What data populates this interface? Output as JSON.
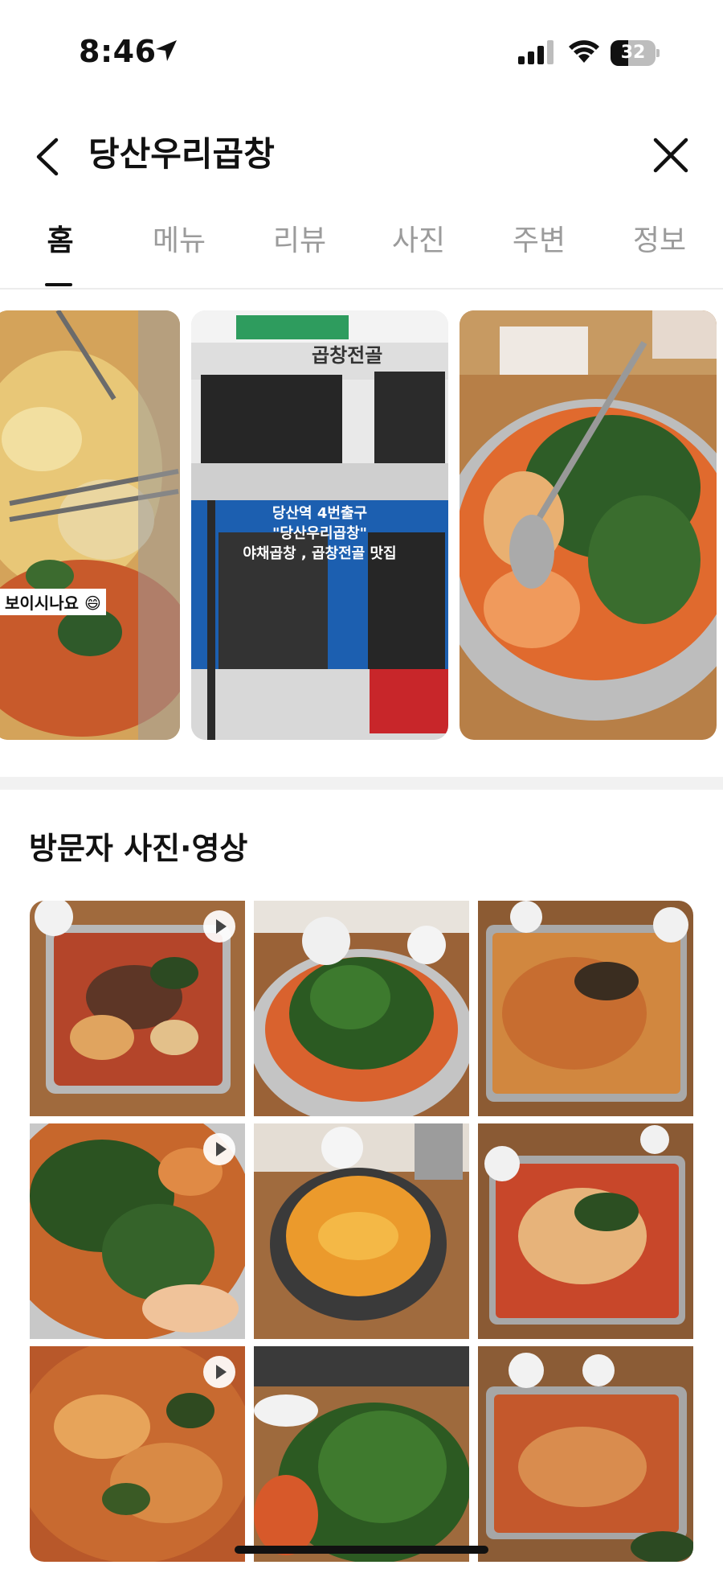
{
  "status": {
    "time": "8:46",
    "battery": "32",
    "icons": [
      "location-arrow-icon",
      "signal-icon",
      "wifi-icon",
      "battery-icon"
    ]
  },
  "header": {
    "title": "당산우리곱창",
    "back_icon": "chevron-left-icon",
    "close_icon": "close-icon"
  },
  "tabs": [
    {
      "label": "홈",
      "active": true
    },
    {
      "label": "메뉴",
      "active": false
    },
    {
      "label": "리뷰",
      "active": false
    },
    {
      "label": "사진",
      "active": false
    },
    {
      "label": "주변",
      "active": false
    },
    {
      "label": "정보",
      "active": false
    }
  ],
  "hero": [
    {
      "caption": "보이시나요 😄"
    },
    {
      "sign": "곱창전골",
      "overlay_line1": "당산역 4번출구",
      "overlay_line2": "\"당산우리곱창\"",
      "overlay_line3": "야채곱창 , 곱창전골 맛집"
    },
    {
      "caption": ""
    }
  ],
  "visitor_section": {
    "title": "방문자 사진·영상"
  },
  "grid": [
    {
      "video": true
    },
    {
      "video": false
    },
    {
      "video": false
    },
    {
      "video": true
    },
    {
      "video": false
    },
    {
      "video": false
    },
    {
      "video": true
    },
    {
      "video": false
    },
    {
      "video": false
    }
  ],
  "colors": {
    "accent": "#111111",
    "inactive_tab": "#9b9b9b",
    "separator": "#f1f1f1"
  }
}
